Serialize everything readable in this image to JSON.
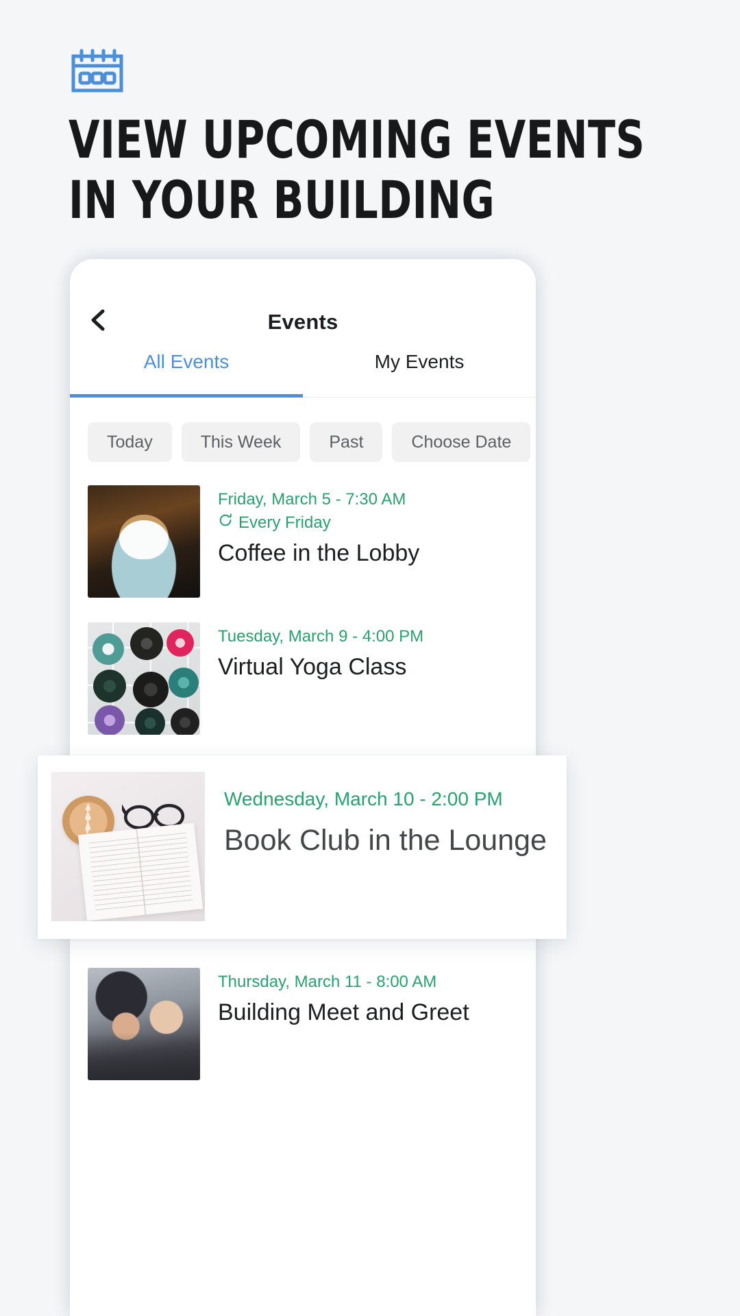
{
  "hero": {
    "icon": "calendar-icon",
    "icon_color": "#4a8fd8",
    "title_line1": "View Upcoming Events",
    "title_line2": "In Your Building"
  },
  "phone": {
    "nav": {
      "back_icon": "chevron-left-icon",
      "title": "Events"
    },
    "tabs": [
      {
        "label": "All Events",
        "active": true
      },
      {
        "label": "My Events",
        "active": false
      }
    ],
    "filters": [
      {
        "label": "Today"
      },
      {
        "label": "This Week"
      },
      {
        "label": "Past"
      },
      {
        "label": "Choose Date"
      }
    ],
    "events": [
      {
        "date": "Friday, March 5 - 7:30 AM",
        "repeat": "Every Friday",
        "repeat_icon": "refresh-icon",
        "name": "Coffee in the Lobby",
        "thumb": "coffee-cup-photo"
      },
      {
        "date": "Tuesday, March 9 - 4:00 PM",
        "repeat": "",
        "name": "Virtual Yoga Class",
        "thumb": "yoga-mats-photo"
      },
      {
        "date": "Thursday, March 11 - 8:00 AM",
        "repeat": "",
        "name": "Building Meet and Greet",
        "thumb": "people-smiling-photo"
      }
    ]
  },
  "highlight": {
    "date": "Wednesday, March 10 - 2:00 PM",
    "name": "Book Club in the Lounge",
    "thumb": "book-latte-glasses-photo"
  },
  "colors": {
    "page_bg": "#f4f6f8",
    "accent_blue": "#4a8fd8",
    "accent_green": "#2aa06f",
    "chip_bg": "#f1f1f2",
    "text_dark": "#1b1d1f"
  }
}
